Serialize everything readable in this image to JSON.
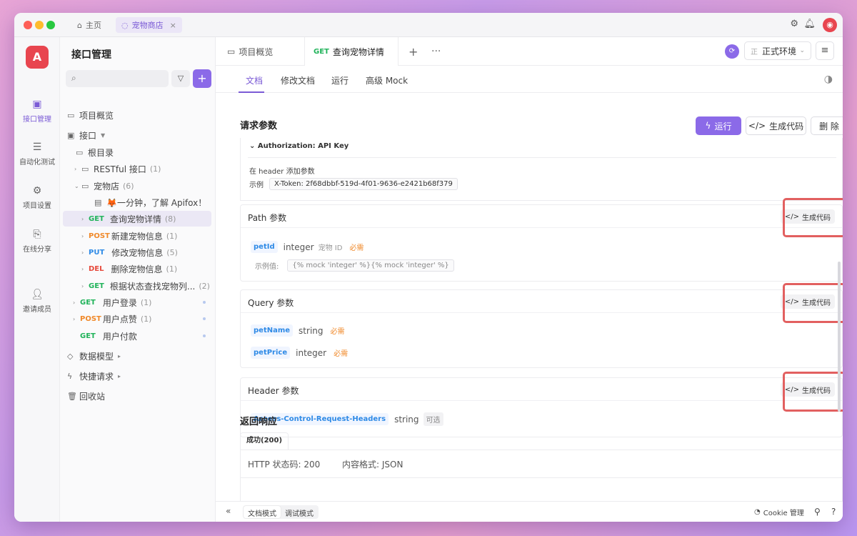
{
  "titlebar": {
    "home_tab": "主页",
    "project_tab": "宠物商店",
    "close": "×"
  },
  "rail": {
    "logo": "A",
    "items": [
      {
        "label": "接口管理",
        "icon": "api-icon"
      },
      {
        "label": "自动化测试",
        "icon": "automation-icon"
      },
      {
        "label": "项目设置",
        "icon": "settings-icon"
      },
      {
        "label": "在线分享",
        "icon": "share-icon"
      },
      {
        "label": "邀请成员",
        "icon": "invite-icon"
      }
    ]
  },
  "sidebar": {
    "title": "接口管理",
    "search_placeholder": "",
    "overview": "项目概览",
    "api_root": "接口",
    "root_dir": "根目录",
    "restful": {
      "label": "RESTful 接口",
      "count": "(1)"
    },
    "petshop": {
      "label": "宠物店",
      "count": "(6)"
    },
    "intro_doc": "🦊一分钟，了解 Apifox！",
    "endpoints": [
      {
        "method": "GET",
        "name": "查询宠物详情",
        "count": "(8)"
      },
      {
        "method": "POST",
        "name": "新建宠物信息",
        "count": "(1)"
      },
      {
        "method": "PUT",
        "name": "修改宠物信息",
        "count": "(5)"
      },
      {
        "method": "DEL",
        "name": "删除宠物信息",
        "count": "(1)"
      },
      {
        "method": "GET",
        "name": "根据状态查找宠物列...",
        "count": "(2)"
      }
    ],
    "user_endpoints": [
      {
        "method": "GET",
        "name": "用户登录",
        "count": "(1)"
      },
      {
        "method": "POST",
        "name": "用户点赞",
        "count": "(1)"
      },
      {
        "method": "GET",
        "name": "用户付款",
        "count": ""
      }
    ],
    "data_model": "数据模型",
    "quick_request": "快捷请求",
    "recycle_bin": "回收站"
  },
  "main": {
    "tabs": [
      {
        "label": "项目概览"
      },
      {
        "method": "GET",
        "label": "查询宠物详情"
      }
    ],
    "env": {
      "prefix": "正",
      "label": "正式环境"
    },
    "subtabs": [
      "文档",
      "修改文档",
      "运行",
      "高级 Mock"
    ],
    "request_params_title": "请求参数",
    "buttons": {
      "run": "运行",
      "gen_code": "生成代码",
      "delete": "删 除"
    },
    "auth": {
      "title": "Authorization: API Key",
      "in_header": "在 header 添加参数",
      "example_label": "示例",
      "example_value": "X-Token: 2f68dbbf-519d-4f01-9636-e2421b68f379"
    },
    "path_params": {
      "title": "Path 参数",
      "gen_code": "生成代码",
      "name": "petId",
      "type": "integer",
      "desc": "宠物 ID",
      "required": "必需",
      "example_label": "示例值:",
      "example_value": "{% mock 'integer' %}{% mock 'integer' %}"
    },
    "query_params": {
      "title": "Query 参数",
      "gen_code": "生成代码",
      "items": [
        {
          "name": "petName",
          "type": "string",
          "required": "必需"
        },
        {
          "name": "petPrice",
          "type": "integer",
          "required": "必需"
        }
      ]
    },
    "header_params": {
      "title": "Header 参数",
      "gen_code": "生成代码",
      "name": "Access-Control-Request-Headers",
      "type": "string",
      "optional": "可选"
    },
    "response": {
      "title": "返回响应",
      "tab": "成功(200)",
      "status_label": "HTTP 状态码: 200",
      "content_type": "内容格式: JSON"
    }
  },
  "bottombar": {
    "modes": [
      "文档模式",
      "调试模式"
    ],
    "cookie": "Cookie 管理"
  },
  "colors": {
    "accent": "#8b6ae8",
    "get": "#20b35a",
    "post": "#f0892a",
    "put": "#2e8ae6",
    "delete": "#e64a3c",
    "highlight": "#e26060"
  }
}
